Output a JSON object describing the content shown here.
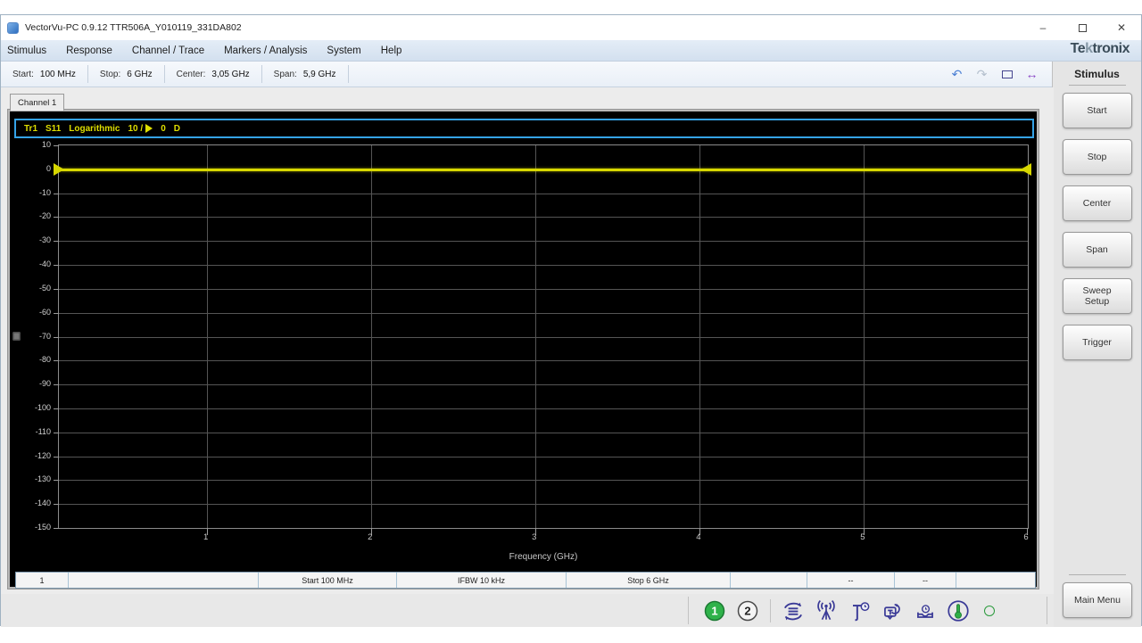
{
  "window": {
    "title": "VectorVu-PC 0.9.12 TTR506A_Y010119_331DA802",
    "controls": [
      {
        "name": "minimize-button",
        "glyph": "–"
      },
      {
        "name": "maximize-button",
        "glyph": ""
      },
      {
        "name": "close-button",
        "glyph": "✕"
      }
    ]
  },
  "menu": {
    "items": [
      "Stimulus",
      "Response",
      "Channel / Trace",
      "Markers / Analysis",
      "System",
      "Help"
    ],
    "brand": {
      "prefix": "Te",
      "k": "k",
      "suffix": "tronix"
    }
  },
  "toolbar": {
    "fields": [
      {
        "label": "Start:",
        "value": "100 MHz"
      },
      {
        "label": "Stop:",
        "value": "6 GHz"
      },
      {
        "label": "Center:",
        "value": "3,05 GHz"
      },
      {
        "label": "Span:",
        "value": "5,9 GHz"
      }
    ],
    "icons": [
      {
        "name": "undo-icon",
        "glyph": "↶"
      },
      {
        "name": "redo-icon",
        "glyph": "↷"
      },
      {
        "name": "zoom-window-icon",
        "glyph": ""
      },
      {
        "name": "pan-arrows-icon",
        "glyph": "↔"
      }
    ]
  },
  "sidebar": {
    "title": "Stimulus",
    "buttons": [
      "Start",
      "Stop",
      "Center",
      "Span",
      "Sweep\nSetup",
      "Trigger"
    ],
    "main_menu_label": "Main Menu"
  },
  "main": {
    "channel_tab": "Channel 1",
    "trace_header": {
      "trace": "Tr1",
      "parameter": "S11",
      "format": "Logarithmic",
      "scale": "10 /",
      "ref_value": "0",
      "ref_unit": "D"
    },
    "status_row": [
      "1",
      "",
      "Start 100 MHz",
      "IFBW 10 kHz",
      "Stop 6 GHz",
      "",
      "--",
      "--",
      ""
    ]
  },
  "status_bar": {
    "channel1": "1",
    "channel2": "2",
    "icons": [
      "channel-1-indicator",
      "channel-2-indicator",
      "sweep-sync-icon",
      "rf-output-icon",
      "trigger-clock-icon",
      "trace-update-icon",
      "save-state-icon",
      "temperature-icon"
    ],
    "ready_indicator_color": "#3ecb52"
  },
  "chart_data": {
    "type": "line",
    "title": "Tr1 S11 Logarithmic 10 dB/div, Ref 0 dB",
    "xlabel": "Frequency (GHz)",
    "ylabel": "",
    "xlim": [
      0.1,
      6
    ],
    "ylim": [
      -150,
      10
    ],
    "x_ticks": [
      1,
      2,
      3,
      4,
      5,
      6
    ],
    "y_ticks": [
      10,
      0,
      -10,
      -20,
      -30,
      -40,
      -50,
      -60,
      -70,
      -80,
      -90,
      -100,
      -110,
      -120,
      -130,
      -140,
      -150
    ],
    "grid": true,
    "legend": "none",
    "series": [
      {
        "name": "Tr1 S11",
        "x": [
          0.1,
          6.0
        ],
        "y": [
          0,
          0
        ],
        "color": "#d8d800",
        "ref_level": 0,
        "scale_per_div": 10
      }
    ]
  }
}
